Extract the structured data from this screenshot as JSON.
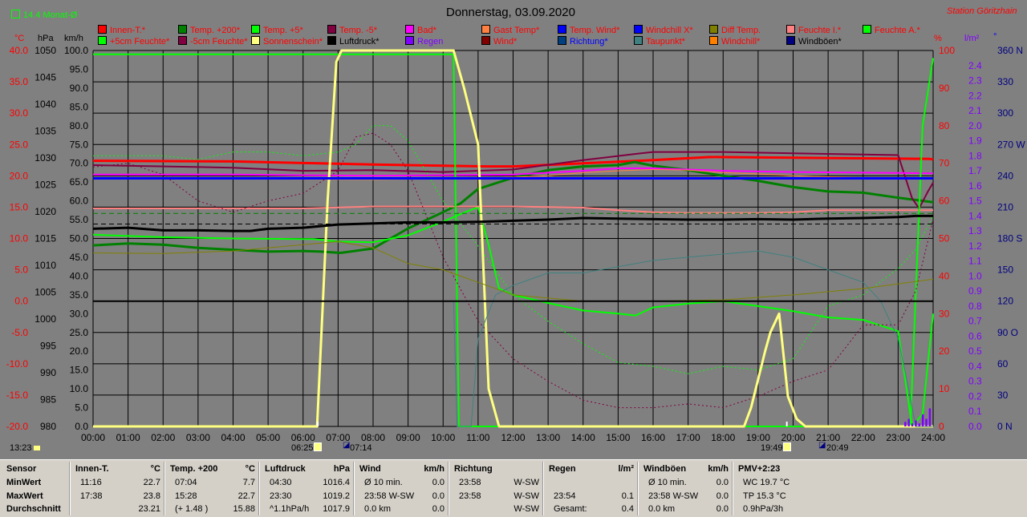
{
  "header": {
    "monthly_avg": "14.4 Monat-Ø",
    "title": "Donnerstag, 03.09.2020",
    "station": "Station Göritzhain"
  },
  "axis_units": {
    "temp": "°C",
    "pressure": "hPa",
    "speed": "km/h",
    "percent": "%",
    "rain": "l/m²",
    "direction": "°"
  },
  "colors": {
    "background": "#808080",
    "grid": "#000000",
    "temp_axis": "#ff0000",
    "rain_axis": "#8000ff",
    "dir_axis": "#000080",
    "percent_axis": "#ff0000"
  },
  "legend": [
    {
      "label": "Innen-T.*",
      "color": "#ff0000",
      "text_color": "#ff0000"
    },
    {
      "label": "Temp. +200*",
      "color": "#008000",
      "text_color": "#ff0000"
    },
    {
      "label": "Temp. +5*",
      "color": "#00ff00",
      "text_color": "#ff0000"
    },
    {
      "label": "Temp. -5*",
      "color": "#800040",
      "text_color": "#ff0000"
    },
    {
      "label": "Bad*",
      "color": "#ff00ff",
      "text_color": "#ff0000"
    },
    {
      "label": "Gast Temp*",
      "color": "#ff8040",
      "text_color": "#ff0000"
    },
    {
      "label": "Temp. Wind*",
      "color": "#0000ff",
      "text_color": "#ff0000"
    },
    {
      "label": "Windchill X*",
      "color": "#0000ff",
      "text_color": "#ff0000"
    },
    {
      "label": "Diff Temp.",
      "color": "#808000",
      "text_color": "#ff0000"
    },
    {
      "label": "Feuchte I.*",
      "color": "#ff8080",
      "text_color": "#ff0000"
    },
    {
      "label": "Feuchte A.*",
      "color": "#00ff00",
      "text_color": "#ff0000"
    },
    {
      "label": "+5cm Feuchte*",
      "color": "#00ff00",
      "text_color": "#ff0000"
    },
    {
      "label": "-5cm Feuchte*",
      "color": "#800040",
      "text_color": "#ff0000"
    },
    {
      "label": "Sonnenschein*",
      "color": "#ffff80",
      "text_color": "#ff0000"
    },
    {
      "label": "Luftdruck*",
      "color": "#000000",
      "text_color": "#000000"
    },
    {
      "label": "Regen",
      "color": "#8000ff",
      "text_color": "#8000ff"
    },
    {
      "label": "Wind*",
      "color": "#800000",
      "text_color": "#ff0000"
    },
    {
      "label": "Richtung*",
      "color": "#004080",
      "text_color": "#0000ff"
    },
    {
      "label": "Taupunkt*",
      "color": "#408080",
      "text_color": "#ff0000"
    },
    {
      "label": "Windchill*",
      "color": "#ff8000",
      "text_color": "#ff0000"
    },
    {
      "label": "Windböen*",
      "color": "#000080",
      "text_color": "#000000"
    }
  ],
  "events": {
    "sunrise": "06:25",
    "civil_twilight_am": "07:14",
    "sunset": "19:49",
    "civil_twilight_pm": "20:49",
    "current_time": "13:23"
  },
  "chart_data": {
    "type": "line",
    "x_range_hours": [
      0,
      24
    ],
    "x_ticks": [
      "00:00",
      "01:00",
      "02:00",
      "03:00",
      "04:00",
      "05:00",
      "06:00",
      "07:00",
      "08:00",
      "09:00",
      "10:00",
      "11:00",
      "12:00",
      "13:00",
      "14:00",
      "15:00",
      "16:00",
      "17:00",
      "18:00",
      "19:00",
      "20:00",
      "21:00",
      "22:00",
      "23:00",
      "24:00"
    ],
    "axes": {
      "temp": {
        "ylim": [
          -20,
          40
        ],
        "ticks": [
          "40.0",
          "35.0",
          "30.0",
          "25.0",
          "20.0",
          "15.0",
          "10.0",
          "5.0",
          "0.0",
          "-5.0",
          "-10.0",
          "-15.0",
          "-20.0"
        ]
      },
      "pressure": {
        "ylim": [
          980,
          1050
        ],
        "ticks": [
          "1050",
          "1045",
          "1040",
          "1035",
          "1030",
          "1025",
          "1020",
          "1015",
          "1010",
          "1005",
          "1000",
          "995",
          "990",
          "985",
          "980"
        ]
      },
      "speed": {
        "ylim": [
          0,
          100
        ],
        "ticks": [
          "100.0",
          "95.0",
          "90.0",
          "85.0",
          "80.0",
          "75.0",
          "70.0",
          "65.0",
          "60.0",
          "55.0",
          "50.0",
          "45.0",
          "40.0",
          "35.0",
          "30.0",
          "25.0",
          "20.0",
          "15.0",
          "10.0",
          "5.0",
          "0.0"
        ]
      },
      "percent": {
        "ylim": [
          0,
          100
        ],
        "ticks": [
          "100",
          "90",
          "80",
          "70",
          "60",
          "50",
          "40",
          "30",
          "20",
          "10",
          "0"
        ]
      },
      "rain": {
        "ylim": [
          0,
          2.5
        ],
        "ticks": [
          "2.4",
          "2.3",
          "2.2",
          "2.1",
          "2.0",
          "1.9",
          "1.8",
          "1.7",
          "1.6",
          "1.5",
          "1.4",
          "1.3",
          "1.2",
          "1.1",
          "1.0",
          "0.9",
          "0.8",
          "0.7",
          "0.6",
          "0.5",
          "0.4",
          "0.3",
          "0.2",
          "0.1",
          "0.0"
        ]
      },
      "direction": {
        "ylim": [
          0,
          360
        ],
        "ticks": [
          "360 N",
          "330",
          "300",
          "270 W",
          "240",
          "210",
          "180 S",
          "150",
          "120",
          "90 O",
          "60",
          "30",
          "0 N"
        ]
      }
    },
    "series": [
      {
        "name": "Innen-T.*",
        "axis": "temp",
        "color": "#ff0000",
        "width": 3,
        "x": [
          0,
          4,
          8,
          11.27,
          12,
          16,
          17.63,
          20,
          23.9,
          24
        ],
        "y": [
          22.4,
          22.3,
          21.8,
          21.5,
          21.5,
          22.5,
          23.0,
          22.9,
          22.7,
          22.6
        ]
      },
      {
        "name": "Temp. +200*",
        "axis": "temp",
        "color": "#008000",
        "width": 3,
        "x": [
          0,
          1,
          2,
          3,
          4,
          5,
          6,
          6.5,
          7.07,
          8,
          9,
          10,
          10.5,
          11,
          12,
          13,
          14,
          15,
          15.47,
          16,
          17,
          18,
          19,
          20,
          21,
          22,
          23,
          24
        ],
        "y": [
          8.9,
          9.2,
          9.0,
          8.5,
          8.2,
          7.9,
          8.0,
          7.9,
          7.7,
          8.4,
          11.6,
          14.2,
          15.6,
          17.9,
          19.7,
          20.9,
          21.5,
          21.7,
          22.2,
          21.6,
          20.9,
          20.0,
          19.2,
          18.2,
          17.5,
          17.3,
          16.5,
          15.8
        ]
      },
      {
        "name": "Temp. +5*",
        "axis": "temp",
        "color": "#00ff00",
        "width": 2,
        "x": [
          0,
          2,
          4,
          6,
          6.3,
          7,
          8,
          9,
          10,
          10.55,
          11,
          11.3,
          11.6,
          12,
          13,
          14,
          15,
          15.5,
          16,
          17,
          18,
          19,
          20,
          21,
          22,
          23,
          23.4,
          23.7,
          24
        ],
        "y": [
          10.6,
          10.2,
          10.0,
          9.9,
          9.9,
          9.5,
          9.4,
          10.5,
          12.7,
          14.0,
          15.0,
          9.0,
          2.0,
          1.0,
          -0.3,
          -1.5,
          -2.0,
          -2.3,
          -1.0,
          -0.4,
          0.0,
          -0.8,
          -1.6,
          -2.6,
          -3.0,
          -4.8,
          -20.0,
          -18.0,
          -2.0
        ]
      },
      {
        "name": "Temp. -5*",
        "axis": "temp",
        "color": "#800040",
        "width": 2,
        "x": [
          0,
          4,
          6,
          8,
          10,
          12,
          14,
          15.5,
          16,
          17,
          18,
          20,
          22,
          23,
          23.4,
          23.6,
          23.85,
          24
        ],
        "y": [
          21.7,
          21.3,
          20.8,
          20.9,
          20.6,
          21.0,
          22.5,
          23.5,
          23.8,
          23.8,
          23.8,
          23.6,
          23.4,
          23.3,
          16.4,
          14.8,
          17.5,
          18.9
        ]
      },
      {
        "name": "Bad*",
        "axis": "temp",
        "color": "#ff00ff",
        "width": 2,
        "x": [
          0,
          4,
          8,
          12,
          14,
          15,
          16,
          17,
          18,
          20,
          22,
          24
        ],
        "y": [
          20.2,
          20.2,
          20.0,
          20.2,
          20.8,
          21.2,
          21.2,
          21.0,
          20.8,
          20.6,
          20.5,
          20.4
        ]
      },
      {
        "name": "Gast Temp*",
        "axis": "temp",
        "color": "#ff8040",
        "width": 1,
        "x": [
          0,
          4,
          8,
          11,
          13,
          14,
          15,
          16,
          17,
          18,
          19,
          20,
          22,
          24
        ],
        "y": [
          19.5,
          19.5,
          19.4,
          19.6,
          20.0,
          20.5,
          20.8,
          21.0,
          20.9,
          20.5,
          20.3,
          20.0,
          19.7,
          19.5
        ]
      },
      {
        "name": "Feuchte I.*",
        "axis": "percent",
        "color": "#ff8080",
        "width": 2,
        "x": [
          0,
          2,
          4,
          6,
          8,
          10,
          12,
          14,
          15,
          16,
          17,
          18,
          19,
          20,
          21,
          22,
          23,
          24
        ],
        "y": [
          58,
          58,
          58,
          58,
          58.5,
          58.5,
          58.5,
          58.2,
          57.5,
          57,
          56.8,
          56.8,
          56.8,
          57,
          57.5,
          57.5,
          57.5,
          57.5
        ]
      },
      {
        "name": "Feuchte A.*",
        "axis": "percent",
        "color": "#00ff00",
        "width": 2,
        "x": [
          0,
          10.3,
          10.45,
          10.6,
          23.15,
          23.35,
          23.7,
          24
        ],
        "y": [
          99,
          99,
          0,
          0,
          0,
          0,
          80,
          98
        ]
      },
      {
        "name": "+5cm Feuchte*",
        "axis": "percent",
        "color": "#00ff00",
        "width": 1,
        "dash": "2,3",
        "x": [
          0,
          1,
          2,
          3,
          4,
          5,
          6,
          7,
          7.5,
          8,
          8.5,
          9,
          10,
          11,
          12,
          13,
          14,
          15,
          16,
          17,
          18,
          19,
          20,
          21,
          22,
          23,
          23.5,
          24
        ],
        "y": [
          72,
          72,
          72,
          71,
          73,
          73,
          72,
          73,
          75,
          80,
          80,
          76,
          60,
          48,
          35,
          28,
          22,
          17,
          16,
          14,
          16,
          15,
          18,
          32,
          35,
          42,
          47,
          56
        ]
      },
      {
        "name": "-5cm Feuchte*",
        "axis": "percent",
        "color": "#800040",
        "width": 1,
        "dash": "2,3",
        "x": [
          0,
          1,
          2,
          3,
          4,
          5,
          6,
          7,
          7.5,
          8,
          8.5,
          9,
          10,
          11,
          12,
          13,
          14,
          15,
          16,
          17,
          18,
          19,
          20,
          21,
          22,
          23,
          23.5,
          24
        ],
        "y": [
          69,
          70,
          67,
          60,
          57,
          60,
          62,
          68,
          77,
          78,
          75,
          68,
          45,
          28,
          18,
          12,
          7,
          5,
          5,
          6,
          5,
          8,
          12,
          15,
          27,
          27,
          36,
          55
        ]
      },
      {
        "name": "Sonnenschein*",
        "axis": "percent",
        "color": "#ffff80",
        "width": 3,
        "x": [
          0,
          6.4,
          6.7,
          6.95,
          7.1,
          10.3,
          10.6,
          11.0,
          11.3,
          11.6,
          18.6,
          18.8,
          19.2,
          19.35,
          19.6,
          19.85,
          20.1,
          20.35,
          24
        ],
        "y": [
          0,
          0,
          60,
          97,
          100,
          100,
          90,
          75,
          10,
          0,
          0,
          5,
          20,
          25,
          30,
          8,
          2,
          0,
          0
        ]
      },
      {
        "name": "Luftdruck*",
        "axis": "pressure",
        "color": "#000000",
        "width": 3,
        "x": [
          0,
          1,
          2,
          3,
          4,
          4.5,
          5,
          6,
          7,
          8,
          9,
          10,
          11,
          12,
          13,
          14,
          15,
          16,
          17,
          18,
          19,
          20,
          21,
          22,
          23,
          23.5,
          24
        ],
        "y": [
          1016.8,
          1017.0,
          1016.5,
          1016.5,
          1016.4,
          1016.4,
          1016.8,
          1017.0,
          1017.6,
          1017.8,
          1018.0,
          1018.0,
          1018.1,
          1018.3,
          1018.5,
          1018.8,
          1018.7,
          1018.6,
          1018.5,
          1018.5,
          1018.6,
          1018.5,
          1018.7,
          1018.8,
          1019.0,
          1019.2,
          1019.2
        ]
      },
      {
        "name": "Taupunkt*",
        "axis": "temp",
        "color": "#408080",
        "width": 1,
        "x": [
          0,
          10.3,
          10.4,
          10.8,
          11,
          11.5,
          12,
          13,
          14,
          15,
          16,
          17,
          18,
          19,
          20,
          21,
          22,
          22.5,
          23,
          23.3,
          23.5,
          24
        ],
        "y": [
          0,
          0,
          -20,
          -20,
          -6,
          1.0,
          2.5,
          4.5,
          4.5,
          5.5,
          6.5,
          7,
          7.5,
          8,
          7,
          5.0,
          3.0,
          0,
          -6,
          -14,
          -20,
          -20
        ]
      },
      {
        "name": "Diff Temp.",
        "axis": "temp",
        "color": "#808000",
        "width": 1,
        "x": [
          0,
          2,
          4,
          6,
          7,
          8,
          9,
          10,
          11,
          12,
          14,
          16,
          18,
          20,
          22,
          24
        ],
        "y": [
          7.7,
          7.6,
          8.0,
          9.0,
          9.5,
          8.5,
          6.0,
          5.0,
          3.0,
          1.0,
          0,
          0,
          0.2,
          1.0,
          2.0,
          3.5
        ]
      },
      {
        "name": "Windchill X*",
        "axis": "temp",
        "color": "#0000ff",
        "width": 3,
        "x": [
          0,
          24
        ],
        "y": [
          19.6,
          19.6
        ]
      },
      {
        "name": "Zero line",
        "axis": "temp",
        "color": "#000000",
        "width": 2,
        "x": [
          0,
          24
        ],
        "y": [
          0,
          0
        ]
      },
      {
        "name": "Dashed green",
        "axis": "temp",
        "color": "#008000",
        "width": 1,
        "dash": "6,4",
        "x": [
          0,
          24
        ],
        "y": [
          14.0,
          14.0
        ]
      },
      {
        "name": "Dashed black",
        "axis": "temp",
        "color": "#000000",
        "width": 1,
        "dash": "6,4",
        "x": [
          0,
          24
        ],
        "y": [
          12.3,
          12.3
        ]
      }
    ],
    "rain_bars": {
      "axis": "rain",
      "color": "#8000ff",
      "x": [
        23.2,
        23.3,
        23.4,
        23.5,
        23.6,
        23.7,
        23.8,
        23.9
      ],
      "y": [
        0.03,
        0.05,
        0.02,
        0.04,
        0.02,
        0.08,
        0.05,
        0.12
      ]
    }
  },
  "table": {
    "row_labels": [
      "Sensor",
      "MinWert",
      "MaxWert",
      "Durchschnitt"
    ],
    "columns": [
      {
        "title": "Innen-T.",
        "unit": "°C",
        "rows": [
          [
            "11:16",
            "22.7"
          ],
          [
            "17:38",
            "23.8"
          ],
          [
            "",
            "23.21"
          ]
        ]
      },
      {
        "title": "Temp. +200",
        "unit": "°C",
        "rows": [
          [
            "07:04",
            "7.7"
          ],
          [
            "15:28",
            "22.7"
          ],
          [
            "(+ 1.48 )",
            "15.88"
          ]
        ]
      },
      {
        "title": "Luftdruck",
        "unit": "hPa",
        "rows": [
          [
            "04:30",
            "1016.4"
          ],
          [
            "23:30",
            "1019.2"
          ],
          [
            "^1.1hPa/h",
            "1017.9"
          ]
        ]
      },
      {
        "title": "Wind",
        "unit": "km/h",
        "rows": [
          [
            "Ø 10 min.",
            "0.0"
          ],
          [
            "23:58  W-SW",
            "0.0"
          ],
          [
            "0.0 km",
            "0.0"
          ]
        ]
      },
      {
        "title": "Richtung",
        "unit": "",
        "rows": [
          [
            "23:58",
            "W-SW"
          ],
          [
            "23:58",
            "W-SW"
          ],
          [
            "",
            "W-SW"
          ]
        ]
      },
      {
        "title": "Regen",
        "unit": "l/m²",
        "rows": [
          [
            "",
            ""
          ],
          [
            "23:54",
            "0.1"
          ],
          [
            "Gesamt:",
            "0.4"
          ]
        ]
      },
      {
        "title": "Windböen",
        "unit": "km/h",
        "rows": [
          [
            "Ø 10 min.",
            "0.0"
          ],
          [
            "23:58  W-SW",
            "0.0"
          ],
          [
            "0.0 km",
            "0.0"
          ]
        ]
      },
      {
        "title": "PMV+2:23",
        "unit": "",
        "rows": [
          [
            "WC 19.7 °C",
            ""
          ],
          [
            "TP 15.3 °C",
            ""
          ],
          [
            "0.9hPa/3h",
            ""
          ]
        ]
      }
    ]
  }
}
